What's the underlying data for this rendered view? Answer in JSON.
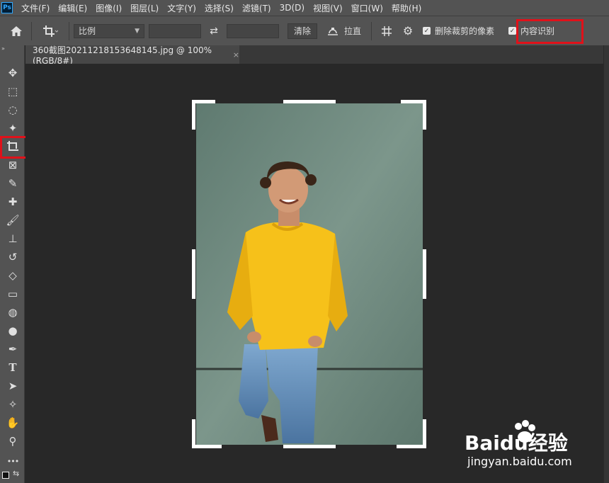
{
  "menubar": {
    "app_logo": "Ps",
    "items": [
      "文件(F)",
      "编辑(E)",
      "图像(I)",
      "图层(L)",
      "文字(Y)",
      "选择(S)",
      "滤镜(T)",
      "3D(D)",
      "视图(V)",
      "窗口(W)",
      "帮助(H)"
    ]
  },
  "options": {
    "ratio_select": "比例",
    "clear_button": "清除",
    "straighten_button": "拉直",
    "delete_cropped_label": "删除裁剪的像素",
    "content_aware_label": "内容识别"
  },
  "document": {
    "tab_title": "360截图20211218153648145.jpg @ 100%(RGB/8#)",
    "close_glyph": "×"
  },
  "tools": [
    {
      "name": "move-tool",
      "glyph": "✥"
    },
    {
      "name": "marquee-tool",
      "glyph": "⬚"
    },
    {
      "name": "lasso-tool",
      "glyph": "◌"
    },
    {
      "name": "magic-wand-tool",
      "glyph": "✦"
    },
    {
      "name": "crop-tool",
      "glyph": "⌗"
    },
    {
      "name": "frame-tool",
      "glyph": "⊠"
    },
    {
      "name": "eyedropper-tool",
      "glyph": "✎"
    },
    {
      "name": "healing-brush-tool",
      "glyph": "✚"
    },
    {
      "name": "brush-tool",
      "glyph": "🖌"
    },
    {
      "name": "clone-stamp-tool",
      "glyph": "⊥"
    },
    {
      "name": "history-brush-tool",
      "glyph": "↺"
    },
    {
      "name": "eraser-tool",
      "glyph": "◇"
    },
    {
      "name": "gradient-tool",
      "glyph": "▭"
    },
    {
      "name": "blur-tool",
      "glyph": "◍"
    },
    {
      "name": "dodge-tool",
      "glyph": "●"
    },
    {
      "name": "pen-tool",
      "glyph": "✒"
    },
    {
      "name": "type-tool",
      "glyph": "T"
    },
    {
      "name": "path-selection-tool",
      "glyph": "➤"
    },
    {
      "name": "shape-tool",
      "glyph": "✧"
    },
    {
      "name": "hand-tool",
      "glyph": "✋"
    },
    {
      "name": "zoom-tool",
      "glyph": "⚲"
    },
    {
      "name": "more-tools",
      "glyph": "•••"
    }
  ],
  "watermark": {
    "brand": "Baidu经验",
    "url": "jingyan.baidu.com"
  },
  "colors": {
    "highlight_red": "#e0111a",
    "panel_gray": "#535353",
    "canvas_bg": "#282828"
  }
}
